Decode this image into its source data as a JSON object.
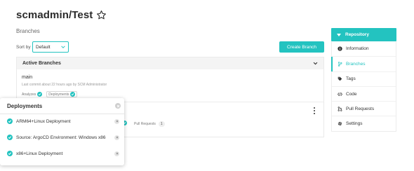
{
  "header": {
    "repo_title": "scmadmin/Test",
    "subtitle": "Branches"
  },
  "toolbar": {
    "sort_label": "Sort by",
    "sort_value": "Default",
    "create_label": "Create Branch"
  },
  "branches_panel": {
    "title": "Active Branches",
    "branches": [
      {
        "name": "main",
        "meta": "Last commit about 22 hours ago by SCM Administrator",
        "analyzes_label": "Analyzes",
        "deployments_label": "Deployments"
      }
    ],
    "second_row": {
      "pull_requests_label": "Pull Requests",
      "pull_requests_count": "1"
    }
  },
  "deployments_popover": {
    "title": "Deployments",
    "items": [
      {
        "label": "ARM64+Linux Deployment"
      },
      {
        "label": "Source: ArgoCD Environment: Windows x86"
      },
      {
        "label": "x86+Linux Deployment"
      }
    ]
  },
  "sidebar": {
    "title": "Repository",
    "items": [
      {
        "label": "Information",
        "icon": "info-icon"
      },
      {
        "label": "Branches",
        "icon": "branch-icon",
        "active": true
      },
      {
        "label": "Tags",
        "icon": "tag-icon"
      },
      {
        "label": "Code",
        "icon": "code-icon"
      },
      {
        "label": "Pull Requests",
        "icon": "pull-request-icon"
      },
      {
        "label": "Settings",
        "icon": "gear-icon"
      }
    ]
  },
  "colors": {
    "accent": "#23c3c0"
  }
}
